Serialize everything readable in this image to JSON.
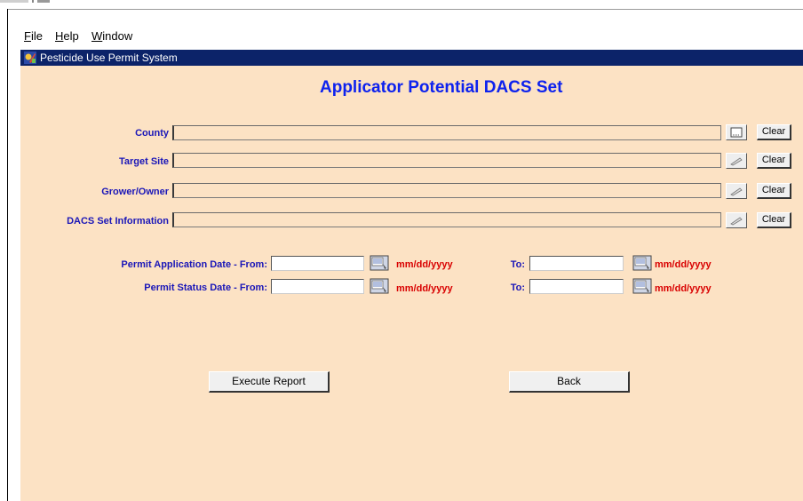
{
  "menubar": {
    "items": [
      {
        "mnemonic": "F",
        "rest": "ile"
      },
      {
        "mnemonic": "H",
        "rest": "elp"
      },
      {
        "mnemonic": "W",
        "rest": "indow"
      }
    ]
  },
  "window": {
    "title": "Pesticide Use Permit System"
  },
  "form": {
    "title": "Applicator Potential DACS Set",
    "county_label": "County",
    "target_site_label": "Target Site",
    "grower_owner_label": "Grower/Owner",
    "dacs_set_label": "DACS Set Information",
    "clear_label": "Clear",
    "permit_app_from_label": "Permit Application Date - From:",
    "permit_status_from_label": "Permit Status Date - From:",
    "to_label": "To:",
    "date_format": "mm/dd/yyyy",
    "execute_label": "Execute Report",
    "back_label": "Back"
  },
  "colors": {
    "panel_bg": "#fce2c4",
    "label_blue": "#1a16b8",
    "title_blue": "#0d22ee",
    "date_red": "#d90000",
    "titlebar_bg": "#0c2369"
  }
}
